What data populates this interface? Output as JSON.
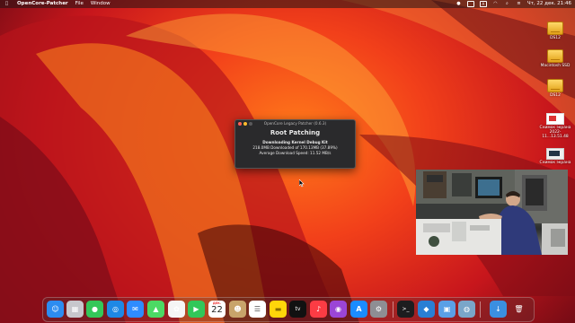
{
  "menubar": {
    "apple_icon": "apple-icon",
    "app_name": "OpenCore-Patcher",
    "menu_file": "File",
    "menu_window": "Window",
    "status_icons": [
      "screen-record-icon",
      "display-icon",
      "keyboard-layout-icon",
      "wifi-icon",
      "search-icon",
      "control-center-icon"
    ],
    "keyboard_layout": "A",
    "datetime": "Чт, 22 дек. 21:46"
  },
  "desktop_icons": [
    {
      "label": "DS12",
      "kind": "drive"
    },
    {
      "label": "Macintosh SSD",
      "kind": "drive"
    },
    {
      "label": "DS12",
      "kind": "drive"
    },
    {
      "label": "Снимок экрана 2022-11...13.51.48",
      "kind": "screenshot"
    },
    {
      "label": "Снимок экрана",
      "kind": "screenshot-dark"
    }
  ],
  "patcher": {
    "title": "OpenCore Legacy Patcher (0.6.3)",
    "heading": "Root Patching",
    "status": "Downloading Kernel Debug Kit",
    "progress_text": "218.0MB Downloaded of 170.13MB (37.89%)",
    "speed_text": "Average Download Speed: 11.52 MB/s",
    "progress_percent": 37.89
  },
  "dock": {
    "items": [
      {
        "name": "finder",
        "glyph": "☺",
        "bg": "#2d8cf0"
      },
      {
        "name": "launchpad",
        "glyph": "▦",
        "bg": "#c7c7cc"
      },
      {
        "name": "messages",
        "glyph": "●",
        "bg": "#34c759"
      },
      {
        "name": "safari",
        "glyph": "◎",
        "bg": "#1e88e5"
      },
      {
        "name": "mail",
        "glyph": "✉",
        "bg": "#2f8cff"
      },
      {
        "name": "maps",
        "glyph": "▲",
        "bg": "#4cd964"
      },
      {
        "name": "photos",
        "glyph": "✿",
        "bg": "#f5f5f5"
      },
      {
        "name": "facetime",
        "glyph": "▶",
        "bg": "#31c759"
      },
      {
        "name": "calendar",
        "glyph": "",
        "bg": "#ffffff"
      },
      {
        "name": "contacts",
        "glyph": "☻",
        "bg": "#c8a46a"
      },
      {
        "name": "reminders",
        "glyph": "☰",
        "bg": "#ffffff"
      },
      {
        "name": "notes",
        "glyph": "▬",
        "bg": "#ffd60a"
      },
      {
        "name": "appletv",
        "glyph": "tv",
        "bg": "#111111"
      },
      {
        "name": "music",
        "glyph": "♪",
        "bg": "#fc3c44"
      },
      {
        "name": "podcasts",
        "glyph": "◉",
        "bg": "#9b45d6"
      },
      {
        "name": "appstore",
        "glyph": "A",
        "bg": "#1b8cff"
      },
      {
        "name": "system-settings",
        "glyph": "⚙",
        "bg": "#8e8e93"
      },
      {
        "name": "terminal",
        "glyph": ">_",
        "bg": "#1d1d1f"
      },
      {
        "name": "opencore-patcher",
        "glyph": "◆",
        "bg": "#2a7fd4"
      },
      {
        "name": "preview",
        "glyph": "▣",
        "bg": "#5aa0e6"
      },
      {
        "name": "disk-utility",
        "glyph": "◍",
        "bg": "#7aa6c9"
      },
      {
        "name": "downloads-folder",
        "glyph": "↓",
        "bg": "#3b8fe0"
      },
      {
        "name": "trash",
        "glyph": "🗑",
        "bg": "#9aa3ab"
      }
    ],
    "calendar_month": "ДЕК.",
    "calendar_day": "22"
  }
}
